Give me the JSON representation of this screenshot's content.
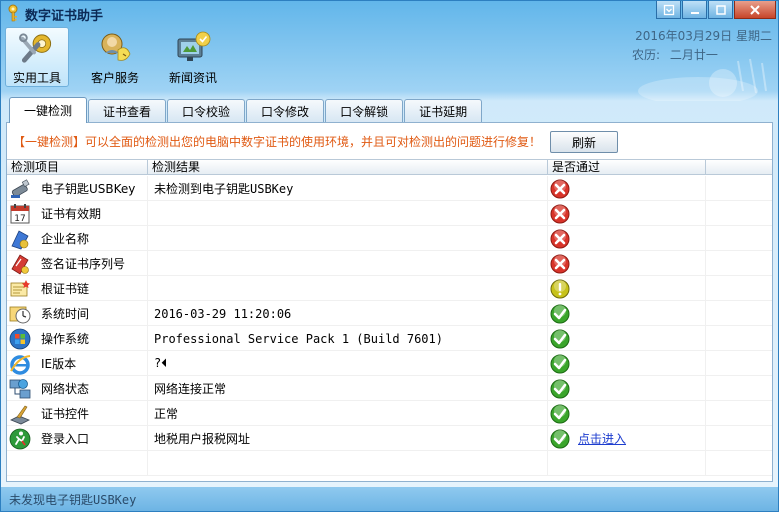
{
  "window": {
    "title": "数字证书助手",
    "min_symbol": "▢",
    "minimize_symbol": "—",
    "maximize_symbol": "□",
    "close_symbol": "✕"
  },
  "toolbar": {
    "items": [
      {
        "label": "实用工具",
        "icon": "tools-icon",
        "active": true
      },
      {
        "label": "客户服务",
        "icon": "customer-service-icon",
        "active": false
      },
      {
        "label": "新闻资讯",
        "icon": "news-icon",
        "active": false
      }
    ]
  },
  "date": {
    "line1": "2016年03月29日 星期二",
    "lunar_label": "农历:",
    "lunar_value": "二月廿一"
  },
  "tabs": [
    "一键检测",
    "证书查看",
    "口令校验",
    "口令修改",
    "口令解锁",
    "证书延期"
  ],
  "active_tab": 0,
  "notice": {
    "prefix": "【一键检测】",
    "text": "可以全面的检测出您的电脑中数字证书的使用环境，并且可对检测出的问题进行修复！"
  },
  "refresh_label": "刷新",
  "grid": {
    "headers": [
      "检测项目",
      "检测结果",
      "是否通过",
      ""
    ],
    "rows": [
      {
        "item": "电子钥匙USBKey",
        "result": "未检测到电子钥匙USBKey",
        "status": "fail",
        "icon": "usb-key-icon"
      },
      {
        "item": "证书有效期",
        "result": "",
        "status": "fail",
        "icon": "calendar-icon"
      },
      {
        "item": "企业名称",
        "result": "",
        "status": "fail",
        "icon": "company-icon"
      },
      {
        "item": "签名证书序列号",
        "result": "",
        "status": "fail",
        "icon": "certificate-icon"
      },
      {
        "item": "根证书链",
        "result": "",
        "status": "warn",
        "icon": "root-cert-icon"
      },
      {
        "item": "系统时间",
        "result": "2016-03-29 11:20:06",
        "status": "pass",
        "icon": "clock-icon"
      },
      {
        "item": "操作系统",
        "result": "Professional Service Pack 1 (Build 7601)",
        "status": "pass",
        "icon": "windows-icon"
      },
      {
        "item": "IE版本",
        "result": "?⏴",
        "status": "pass",
        "icon": "ie-icon"
      },
      {
        "item": "网络状态",
        "result": "网络连接正常",
        "status": "pass",
        "icon": "network-icon"
      },
      {
        "item": "证书控件",
        "result": "正常",
        "status": "pass",
        "icon": "control-icon"
      },
      {
        "item": "登录入口",
        "result": "地税用户报税网址",
        "status": "pass",
        "icon": "login-icon",
        "link": "点击进入"
      }
    ]
  },
  "statusbar": {
    "text": "未发现电子钥匙USBKey"
  },
  "colors": {
    "notice": "#e05a13",
    "link": "#1e3ecf",
    "pass": "#3aa52b",
    "fail": "#d8342a",
    "warn": "#c7c21a"
  }
}
